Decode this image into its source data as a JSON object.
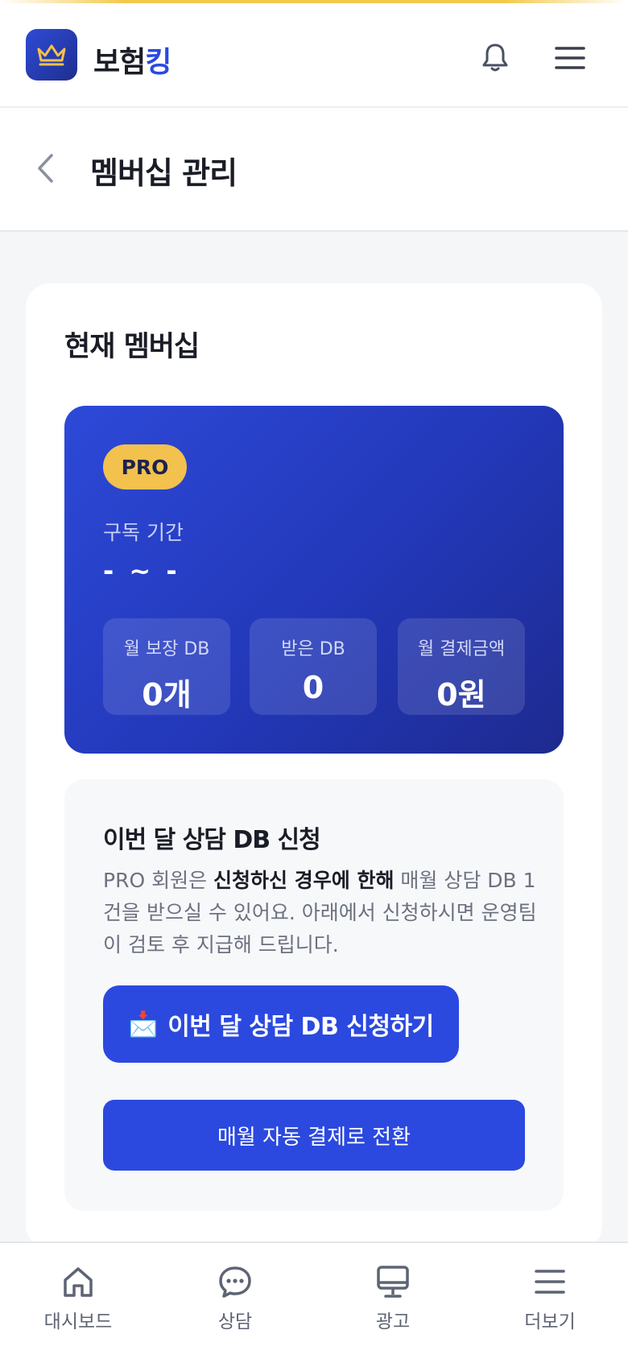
{
  "brand": {
    "name_main": "보험",
    "name_accent": "킹",
    "accent_color": "#2b49df",
    "logo_icon": "crown-icon"
  },
  "header": {
    "bell_icon": "bell-icon",
    "menu_icon": "hamburger-menu-icon"
  },
  "page": {
    "title": "멤버십 관리",
    "back_icon": "chevron-left-icon"
  },
  "membership": {
    "section_title": "현재 멤버십",
    "tier_badge": "PRO",
    "period_label": "구독 기간",
    "period_value": "- ~ -",
    "stats": [
      {
        "label": "월 보장 DB",
        "value": "0개"
      },
      {
        "label": "받은 DB",
        "value": "0"
      },
      {
        "label": "월 결제금액",
        "value": "0원"
      }
    ]
  },
  "apply": {
    "title": "이번 달 상담 DB 신청",
    "desc_prefix": "PRO 회원은 ",
    "desc_bold": "신청하신 경우에 한해",
    "desc_suffix": " 매월 상담 DB 1건을 받으실 수 있어요. 아래에서 신청하시면 운영팀이 검토 후 지급해 드립니다.",
    "button_label": "이번 달 상담 DB 신청하기",
    "button_emoji": "📩",
    "auto_button_label": "매월 자동 결제로 전환"
  },
  "bottom_nav": [
    {
      "label": "대시보드",
      "icon": "home-icon"
    },
    {
      "label": "상담",
      "icon": "chat-bubble-icon"
    },
    {
      "label": "광고",
      "icon": "monitor-icon"
    },
    {
      "label": "더보기",
      "icon": "hamburger-menu-icon"
    }
  ]
}
